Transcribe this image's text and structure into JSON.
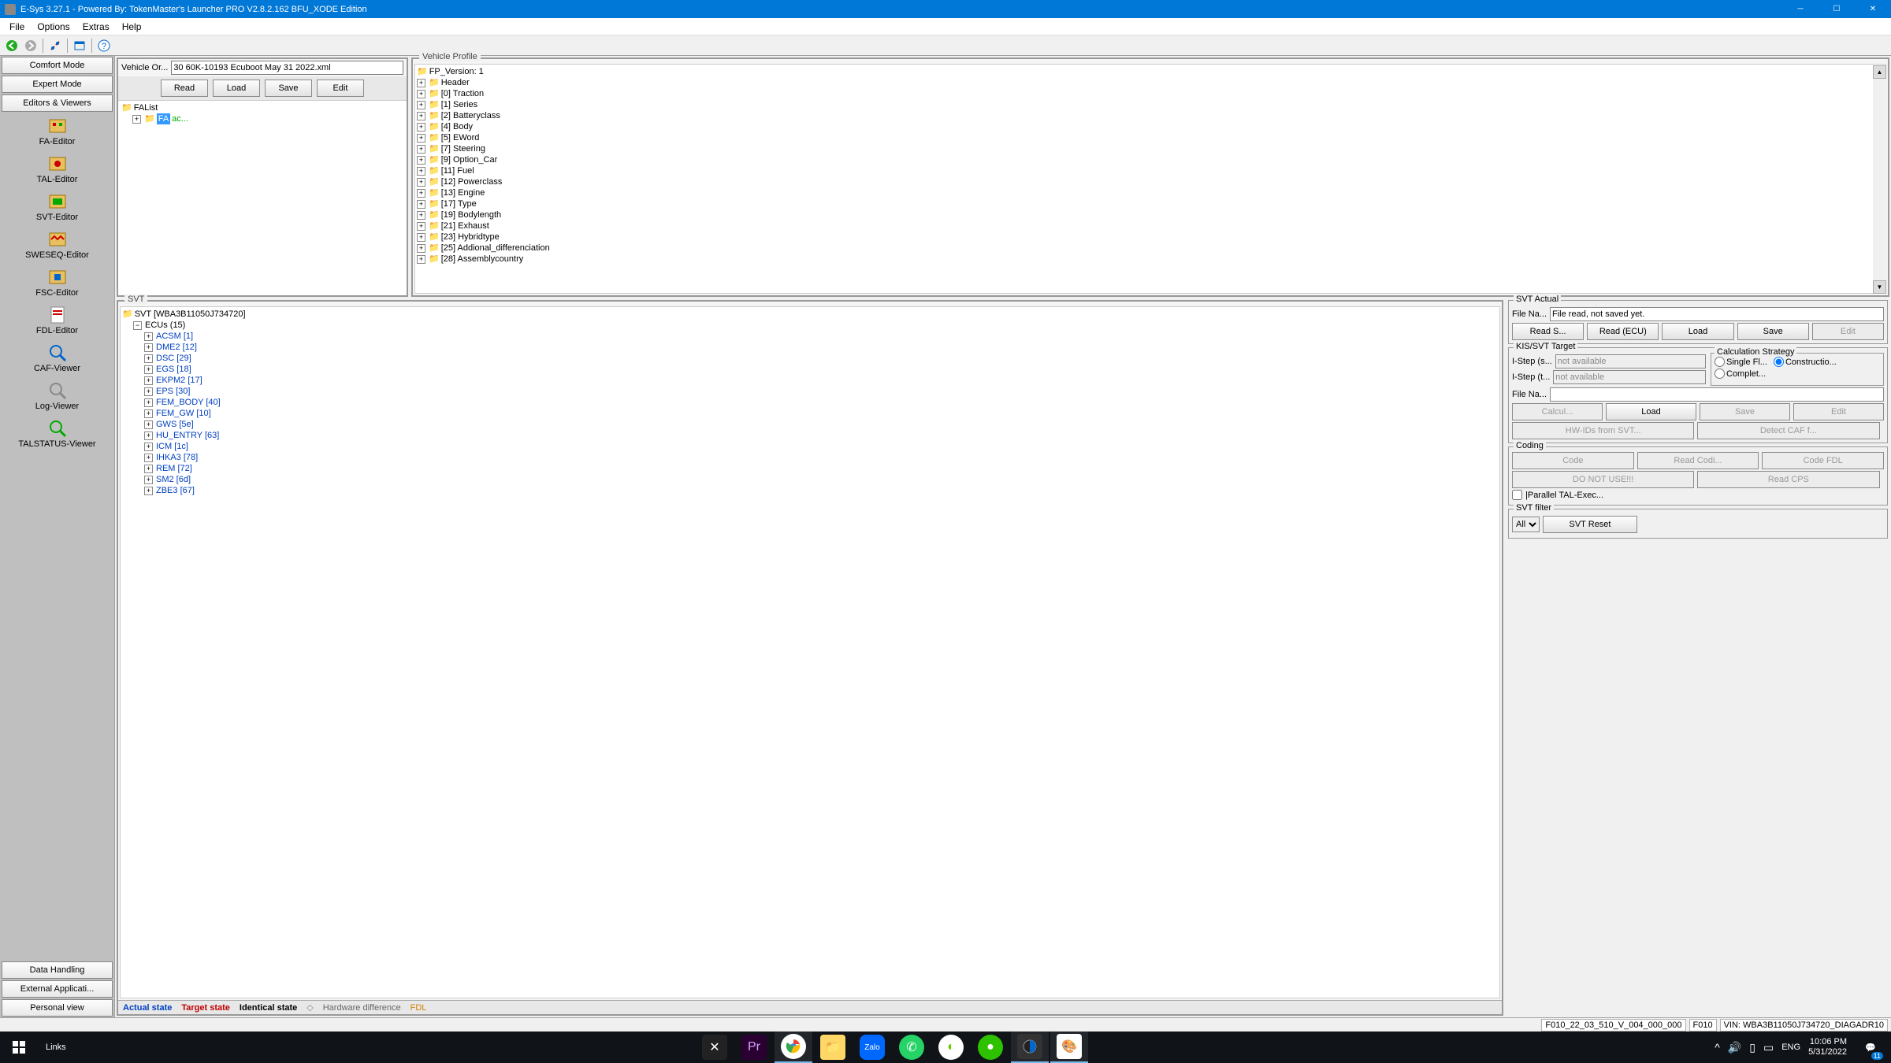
{
  "window": {
    "title": "E-Sys 3.27.1 - Powered By: TokenMaster's Launcher PRO V2.8.2.162 BFU_XODE Edition"
  },
  "menu": {
    "file": "File",
    "options": "Options",
    "extras": "Extras",
    "help": "Help"
  },
  "sidebar": {
    "modes": [
      "Comfort Mode",
      "Expert Mode",
      "Editors & Viewers"
    ],
    "tools": [
      {
        "label": "FA-Editor"
      },
      {
        "label": "TAL-Editor"
      },
      {
        "label": "SVT-Editor"
      },
      {
        "label": "SWESEQ-Editor"
      },
      {
        "label": "FSC-Editor"
      },
      {
        "label": "FDL-Editor"
      },
      {
        "label": "CAF-Viewer"
      },
      {
        "label": "Log-Viewer"
      },
      {
        "label": "TALSTATUS-Viewer"
      }
    ],
    "bottom": [
      "Data Handling",
      "External Applicati...",
      "Personal view"
    ]
  },
  "vo": {
    "label": "Vehicle Or...",
    "value": "30 60K-10193 Ecuboot May 31 2022.xml",
    "buttons": {
      "read": "Read",
      "load": "Load",
      "save": "Save",
      "edit": "Edit"
    },
    "tree": {
      "root": "FAList",
      "fa": "FA",
      "suffix": "ac..."
    }
  },
  "vp": {
    "title": "Vehicle Profile",
    "items": [
      "FP_Version: 1",
      "Header",
      "[0] Traction",
      "[1] Series",
      "[2] Batteryclass",
      "[4] Body",
      "[5] EWord",
      "[7] Steering",
      "[9] Option_Car",
      "[11] Fuel",
      "[12] Powerclass",
      "[13] Engine",
      "[17] Type",
      "[19] Bodylength",
      "[21] Exhaust",
      "[23] Hybridtype",
      "[25] Addional_differenciation",
      "[28] Assemblycountry"
    ]
  },
  "svt": {
    "title": "SVT",
    "root": "SVT [WBA3B11050J734720]",
    "ecusLabel": "ECUs (15)",
    "ecus": [
      "ACSM [1]",
      "DME2 [12]",
      "DSC [29]",
      "EGS [18]",
      "EKPM2 [17]",
      "EPS [30]",
      "FEM_BODY [40]",
      "FEM_GW [10]",
      "GWS [5e]",
      "HU_ENTRY [63]",
      "ICM [1c]",
      "IHKA3 [78]",
      "REM [72]",
      "SM2 [6d]",
      "ZBE3 [67]"
    ],
    "legend": {
      "actual": "Actual state",
      "target": "Target state",
      "identical": "Identical state",
      "hw": "Hardware difference",
      "fdl": "FDL"
    }
  },
  "svtActual": {
    "title": "SVT Actual",
    "fileLabel": "File Na...",
    "fileValue": "File read, not saved yet.",
    "buttons": {
      "readS": "Read S...",
      "readEcu": "Read (ECU)",
      "load": "Load",
      "save": "Save",
      "edit": "Edit"
    }
  },
  "kisSvt": {
    "title": "KIS/SVT Target",
    "istepS": "I-Step (s...",
    "istepT": "I-Step (t...",
    "na": "not available",
    "calcTitle": "Calculation Strategy",
    "single": "Single Fl...",
    "complete": "Complet...",
    "construct": "Constructio...",
    "fileLabel": "File Na...",
    "buttons": {
      "calc": "Calcul...",
      "load": "Load",
      "save": "Save",
      "edit": "Edit",
      "hw": "HW-IDs from SVT...",
      "detect": "Detect CAF f..."
    }
  },
  "coding": {
    "title": "Coding",
    "buttons": {
      "code": "Code",
      "readCodi": "Read Codi...",
      "codeFdl": "Code FDL",
      "dnu": "DO NOT USE!!!",
      "readCps": "Read CPS"
    },
    "parallel": "|Parallel TAL-Exec..."
  },
  "svtFilter": {
    "title": "SVT filter",
    "all": "All",
    "reset": "SVT Reset"
  },
  "statusbar": {
    "f1": "F010_22_03_510_V_004_000_000",
    "f2": "F010",
    "f3": "VIN: WBA3B11050J734720_DIAGADR10"
  },
  "taskbar": {
    "search": "Links",
    "lang": "ENG",
    "time": "10:06 PM",
    "date": "5/31/2022",
    "notif": "11"
  }
}
